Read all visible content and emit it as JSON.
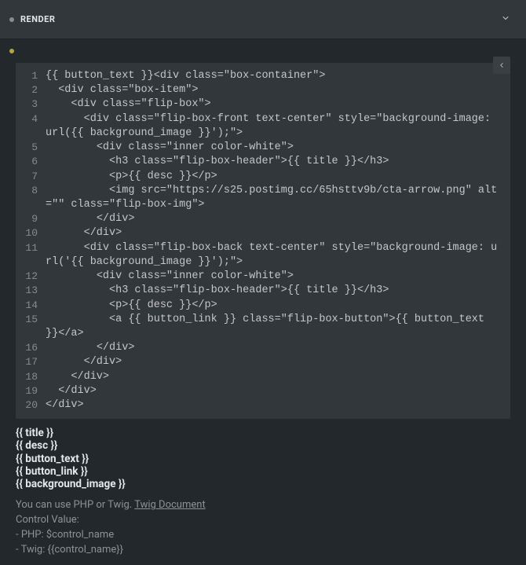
{
  "header": {
    "title": "RENDER"
  },
  "chart_data": null,
  "code": {
    "lines": [
      {
        "n": 1,
        "t": "{{ button_text }}<div class=\"box-container\">"
      },
      {
        "n": 2,
        "t": "  <div class=\"box-item\">"
      },
      {
        "n": 3,
        "t": "    <div class=\"flip-box\">"
      },
      {
        "n": 4,
        "t": "      <div class=\"flip-box-front text-center\" style=\"background-image: url({{ background_image }}');\">"
      },
      {
        "n": 5,
        "t": "        <div class=\"inner color-white\">"
      },
      {
        "n": 6,
        "t": "          <h3 class=\"flip-box-header\">{{ title }}</h3>"
      },
      {
        "n": 7,
        "t": "          <p>{{ desc }}</p>"
      },
      {
        "n": 8,
        "t": "          <img src=\"https://s25.postimg.cc/65hsttv9b/cta-arrow.png\" alt=\"\" class=\"flip-box-img\">"
      },
      {
        "n": 9,
        "t": "        </div>"
      },
      {
        "n": 10,
        "t": "      </div>"
      },
      {
        "n": 11,
        "t": "      <div class=\"flip-box-back text-center\" style=\"background-image: url('{{ background_image }}');\">"
      },
      {
        "n": 12,
        "t": "        <div class=\"inner color-white\">"
      },
      {
        "n": 13,
        "t": "          <h3 class=\"flip-box-header\">{{ title }}</h3>"
      },
      {
        "n": 14,
        "t": "          <p>{{ desc }}</p>"
      },
      {
        "n": 15,
        "t": "          <a {{ button_link }} class=\"flip-box-button\">{{ button_text }}</a>"
      },
      {
        "n": 16,
        "t": "        </div>"
      },
      {
        "n": 17,
        "t": "      </div>"
      },
      {
        "n": 18,
        "t": "    </div>"
      },
      {
        "n": 19,
        "t": "  </div>"
      },
      {
        "n": 20,
        "t": "</div>"
      }
    ]
  },
  "vars": [
    "{{ title }}",
    "{{ desc }}",
    "{{ button_text }}",
    "{{ button_link }}",
    "{{ background_image }}"
  ],
  "hint": {
    "prefix": "You can use PHP or Twig. ",
    "link_text": "Twig Document",
    "control_label": "Control Value:",
    "php_line": "- PHP: $control_name",
    "twig_line": "- Twig: {{control_name}}"
  }
}
